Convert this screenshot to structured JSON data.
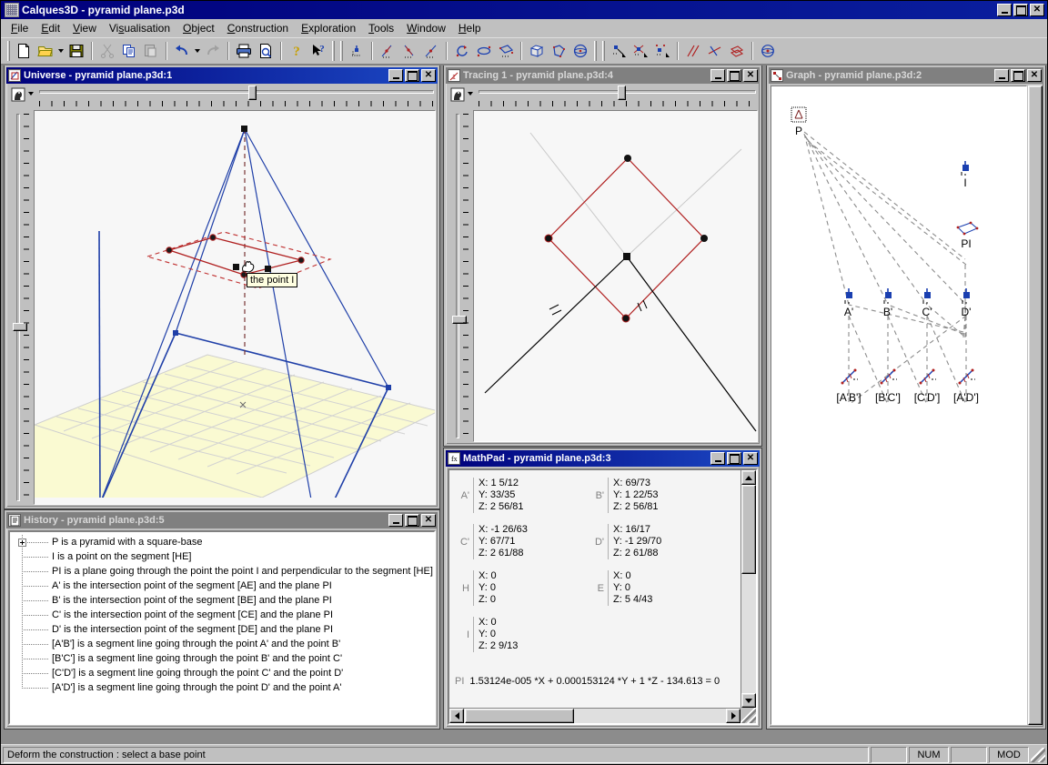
{
  "app": {
    "title": "Calques3D - pyramid plane.p3d",
    "icon": "calques3d-app-icon"
  },
  "window_buttons": {
    "minimize": "_",
    "maximize": "□",
    "close": "✕"
  },
  "menu": [
    {
      "label": "File",
      "mnemonic": "F"
    },
    {
      "label": "Edit",
      "mnemonic": "E"
    },
    {
      "label": "View",
      "mnemonic": "V"
    },
    {
      "label": "Visualisation",
      "mnemonic": "s"
    },
    {
      "label": "Object",
      "mnemonic": "O"
    },
    {
      "label": "Construction",
      "mnemonic": "C"
    },
    {
      "label": "Exploration",
      "mnemonic": "E"
    },
    {
      "label": "Tools",
      "mnemonic": "T"
    },
    {
      "label": "Window",
      "mnemonic": "W"
    },
    {
      "label": "Help",
      "mnemonic": "H"
    }
  ],
  "toolbar": {
    "groups": [
      [
        "new-document",
        "open-folder",
        "open-dropdown",
        "save-disk"
      ],
      [
        "cut-scissors",
        "copy-pages",
        "paste-clipboard"
      ],
      [
        "undo-arrow",
        "undo-dropdown",
        "redo-arrow"
      ],
      [
        "print",
        "print-preview"
      ],
      [
        "help-question",
        "context-help"
      ],
      [
        "create-point"
      ],
      [
        "point-on-object",
        "intersection-point",
        "midpoint"
      ],
      [
        "rotate-arc",
        "ellipse-rotate",
        "plane-rotate"
      ],
      [
        "cube-solid",
        "polyhedron",
        "sphere"
      ],
      [
        "select-point-tool",
        "select-line-tool",
        "select-plane-tool"
      ],
      [
        "parallel-lines",
        "perpendicular-line",
        "parallel-plane"
      ],
      [
        "sphere-point"
      ]
    ]
  },
  "windows": {
    "universe": {
      "title": "Universe - pyramid plane.p3d:1",
      "icon": "universe-window-icon",
      "active": true,
      "tooltip": "the point I",
      "slider_icon": "head-profile-icon"
    },
    "tracing": {
      "title": "Tracing 1 - pyramid plane.p3d:4",
      "icon": "tracing-window-icon",
      "active": false,
      "slider_icon": "head-profile-icon"
    },
    "graph": {
      "title": "Graph - pyramid plane.p3d:2",
      "icon": "graph-window-icon",
      "active": false,
      "nodes": [
        {
          "id": "P",
          "label": "P",
          "type": "pyramid"
        },
        {
          "id": "I",
          "label": "I",
          "type": "point"
        },
        {
          "id": "PI",
          "label": "PI",
          "type": "plane"
        },
        {
          "id": "Ap",
          "label": "A'",
          "type": "point"
        },
        {
          "id": "Bp",
          "label": "B'",
          "type": "point"
        },
        {
          "id": "Cp",
          "label": "C'",
          "type": "point"
        },
        {
          "id": "Dp",
          "label": "D'",
          "type": "point"
        },
        {
          "id": "ABp",
          "label": "[A'B']",
          "type": "segment"
        },
        {
          "id": "BCp",
          "label": "[B'C']",
          "type": "segment"
        },
        {
          "id": "CDp",
          "label": "[C'D']",
          "type": "segment"
        },
        {
          "id": "ADp",
          "label": "[A'D']",
          "type": "segment"
        }
      ]
    },
    "history": {
      "title": "History - pyramid plane.p3d:5",
      "icon": "history-window-icon",
      "active": false,
      "items": [
        {
          "text": "P is a pyramid with a square-base",
          "expandable": true
        },
        {
          "text": "I is a point on the segment [HE]",
          "expandable": false
        },
        {
          "text": "PI is a plane going through the point the point I and perpendicular to the segment [HE]",
          "expandable": false
        },
        {
          "text": "A' is the intersection point of the segment [AE] and the plane PI",
          "expandable": false
        },
        {
          "text": "B' is the intersection point of the segment [BE] and the plane PI",
          "expandable": false
        },
        {
          "text": "C' is the intersection point of the segment [CE] and the plane PI",
          "expandable": false
        },
        {
          "text": "D' is the intersection point of the segment [DE] and the plane PI",
          "expandable": false
        },
        {
          "text": "[A'B'] is a segment line going through the point A' and the point B'",
          "expandable": false
        },
        {
          "text": "[B'C'] is a segment line going through the point B' and the point C'",
          "expandable": false
        },
        {
          "text": "[C'D'] is a segment line going through the point C' and the point D'",
          "expandable": false
        },
        {
          "text": "[A'D'] is a segment line going through the point D' and the point A'",
          "expandable": false
        }
      ]
    },
    "mathpad": {
      "title": "MathPad - pyramid plane.p3d:3",
      "icon": "mathpad-window-icon",
      "active": true,
      "points": [
        {
          "name": "A'",
          "x": "X: 1 5/12",
          "y": "Y: 33/35",
          "z": "Z: 2 56/81"
        },
        {
          "name": "B'",
          "x": "X: 69/73",
          "y": "Y: 1 22/53",
          "z": "Z: 2 56/81"
        },
        {
          "name": "C'",
          "x": "X: -1 26/63",
          "y": "Y: 67/71",
          "z": "Z: 2 61/88"
        },
        {
          "name": "D'",
          "x": "X: 16/17",
          "y": "Y: -1 29/70",
          "z": "Z: 2 61/88"
        },
        {
          "name": "H",
          "x": "X: 0",
          "y": "Y: 0",
          "z": "Z: 0"
        },
        {
          "name": "E",
          "x": "X: 0",
          "y": "Y: 0",
          "z": "Z: 5 4/43"
        },
        {
          "name": "I",
          "x": "X: 0",
          "y": "Y: 0",
          "z": "Z: 2 9/13"
        }
      ],
      "equation_label": "PI",
      "equation": "1.53124e-005 *X + 0.000153124 *Y  + 1 *Z - 134.613 = 0"
    }
  },
  "statusbar": {
    "message": "Deform the construction : select a base point",
    "pane1": "",
    "num": "NUM",
    "pane3": "",
    "mod": "MOD"
  },
  "colors": {
    "titlebar_active": "#00007b",
    "titlebar_inactive": "#808080",
    "face": "#c0c0c0",
    "pyramid_blue": "#1f3fa8",
    "plane_red": "#b02020",
    "ground_yellow": "#fafad2",
    "tooltip_bg": "#ffffe1"
  }
}
